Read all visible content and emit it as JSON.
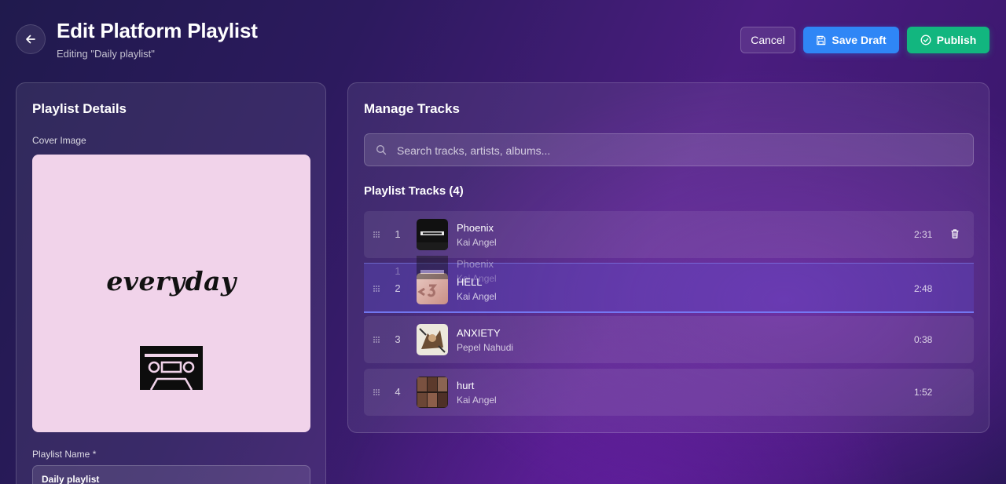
{
  "header": {
    "title": "Edit Platform Playlist",
    "subtitle": "Editing \"Daily playlist\"",
    "cancel_label": "Cancel",
    "save_draft_label": "Save Draft",
    "publish_label": "Publish"
  },
  "details": {
    "heading": "Playlist Details",
    "cover_label": "Cover Image",
    "cover_text": "everyday",
    "name_label": "Playlist Name *",
    "name_value": "Daily playlist"
  },
  "manage": {
    "heading": "Manage Tracks",
    "search_placeholder": "Search tracks, artists, albums...",
    "tracks_heading": "Playlist Tracks (4)"
  },
  "tracks": [
    {
      "num": "1",
      "title": "Phoenix",
      "artist": "Kai Angel",
      "duration": "2:31"
    },
    {
      "num": "2",
      "title": "HELL",
      "artist": "Kai Angel",
      "duration": "2:48"
    },
    {
      "num": "3",
      "title": "ANXIETY",
      "artist": "Pepel Nahudi",
      "duration": "0:38"
    },
    {
      "num": "4",
      "title": "hurt",
      "artist": "Kai Angel",
      "duration": "1:52"
    }
  ],
  "drag_ghost": {
    "num": "1",
    "title": "Phoenix",
    "artist": "Kai Angel"
  },
  "icons": {
    "back": "arrow-left-icon",
    "save": "floppy-disk-icon",
    "publish": "check-circle-icon",
    "search": "search-icon",
    "grip": "drag-handle-icon",
    "delete": "trash-icon",
    "cover_art": "cassette-tape-icon"
  },
  "colors": {
    "save_draft": "#2f86f6",
    "publish": "#12b67f",
    "cover_bg": "#f1d3ea"
  }
}
